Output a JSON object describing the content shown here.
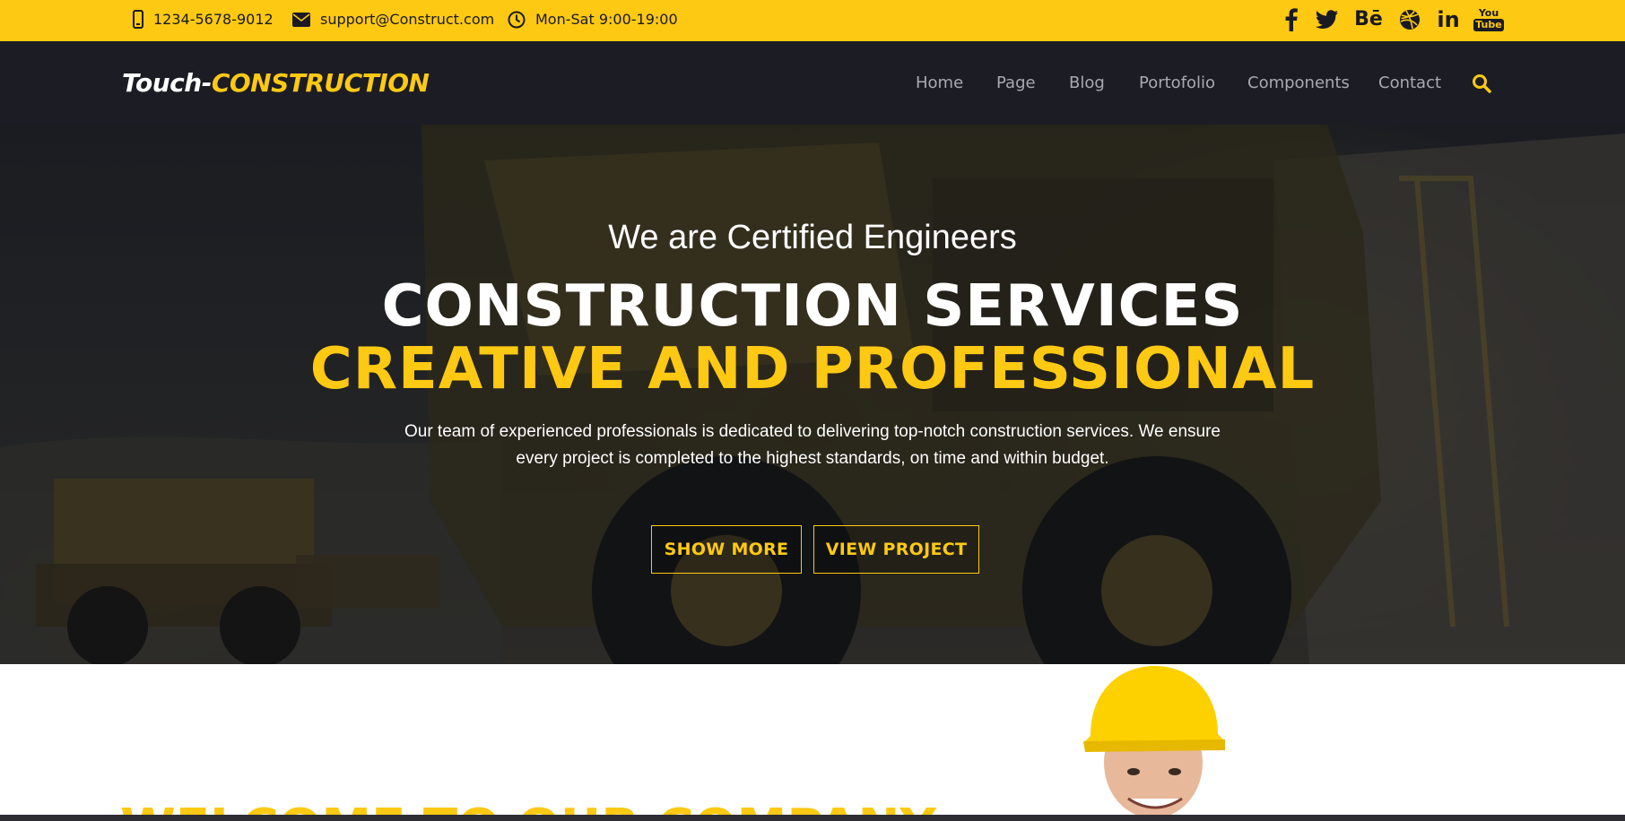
{
  "topbar": {
    "phone": "1234-5678-9012",
    "email": "support@Construct.com",
    "hours": "Mon-Sat 9:00-19:00",
    "social_icons": [
      "facebook-icon",
      "twitter-icon",
      "behance-icon",
      "dribbble-icon",
      "linkedin-icon",
      "youtube-icon"
    ],
    "youtube_text_top": "You",
    "youtube_text_bottom": "Tube",
    "behance_text": "Bē",
    "linkedin_text": "in"
  },
  "brand": {
    "part1": "Touch-",
    "part2": "CONSTRUCTION"
  },
  "nav": {
    "items": [
      "Home",
      "Page",
      "Blog",
      "Portofolio",
      "Components",
      "Contact"
    ],
    "search_icon": "search-icon"
  },
  "hero": {
    "eyebrow": "We are Certified Engineers",
    "title_line1": "CONSTRUCTION SERVICES",
    "title_line2": "CREATIVE AND PROFESSIONAL",
    "lead_line1": "Our team of experienced professionals is dedicated to delivering top-notch construction services. We ensure",
    "lead_line2": "every project is completed to the highest standards, on time and within budget.",
    "btn_primary": "SHOW MORE",
    "btn_secondary": "VIEW PROJECT"
  },
  "welcome": {
    "title": "WELCOME TO OUR COMPANY"
  },
  "colors": {
    "accent": "#fdc913",
    "nav_bg": "#1c1c25",
    "nav_text": "#a9aab0"
  }
}
